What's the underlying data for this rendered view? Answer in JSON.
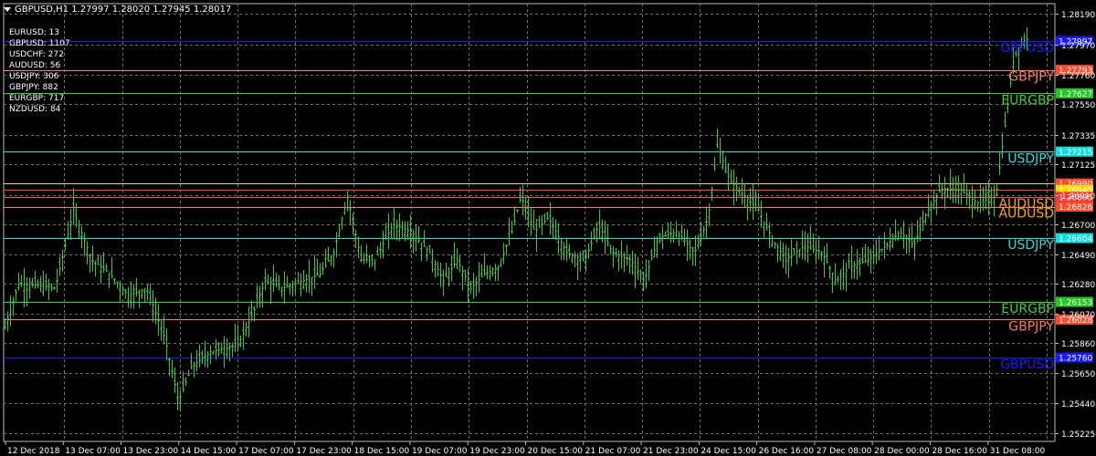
{
  "header": {
    "symbol_info": "GBPUSD,H1  1.27997 1.28020 1.27945 1.28017"
  },
  "counts": [
    {
      "label": "EURUSD: 13"
    },
    {
      "label": "GBPUSD: 1107"
    },
    {
      "label": "USDCHF: 272"
    },
    {
      "label": "AUDUSD: 56"
    },
    {
      "label": "USDJPY: 306"
    },
    {
      "label": "GBPJPY: 882"
    },
    {
      "label": "EURGBP: 717"
    },
    {
      "label": "NZDUSD: 84"
    }
  ],
  "price_axis": {
    "ticks": [
      "1.28190",
      "1.27970",
      "1.27760",
      "1.27550",
      "1.27335",
      "1.27125",
      "1.26910",
      "1.26700",
      "1.26490",
      "1.26280",
      "1.26070",
      "1.25860",
      "1.25650",
      "1.25440",
      "1.25225"
    ]
  },
  "time_axis": {
    "labels": [
      "12 Dec 2018",
      "13 Dec 07:00",
      "13 Dec 23:00",
      "14 Dec 15:00",
      "17 Dec 07:00",
      "17 Dec 23:00",
      "18 Dec 15:00",
      "19 Dec 07:00",
      "19 Dec 23:00",
      "20 Dec 15:00",
      "21 Dec 07:00",
      "21 Dec 23:00",
      "24 Dec 15:00",
      "26 Dec 16:00",
      "27 Dec 08:00",
      "28 Dec 00:00",
      "28 Dec 16:00",
      "31 Dec 08:00"
    ]
  },
  "levels": [
    {
      "price": "1.27997",
      "name": "GBPUSD",
      "line_color": "#1a1aff",
      "box_color": "#1a1aff",
      "text_color": "#1a1aff"
    },
    {
      "price": "1.27793",
      "name": "GBPJPY",
      "line_color": "#ff7a5c",
      "box_color": "#ff4b2b",
      "text_color": "#ff7a5c"
    },
    {
      "price": "1.27627",
      "name": "EURGBP",
      "line_color": "#33d633",
      "box_color": "#22c722",
      "text_color": "#33d633"
    },
    {
      "price": "1.27215",
      "name": "USDJPY",
      "line_color": "#22dddd",
      "box_color": "#11dddd",
      "text_color": "#22dddd"
    },
    {
      "price": "1.26990",
      "name": "",
      "line_color": "#ffd700",
      "box_color": "#ff4b2b",
      "text_color": "#ffa500"
    },
    {
      "price": "1.26945",
      "name": "",
      "line_color": "#ff4b2b",
      "box_color": "#ffd700",
      "text_color": "#ffa500"
    },
    {
      "price": "1.26895",
      "name": "AUDUSD",
      "line_color": "#ff5050",
      "box_color": "#ff3030",
      "text_color": "#ffa500"
    },
    {
      "price": "1.26826",
      "name": "AUDUSD",
      "line_color": "#ff7a5c",
      "box_color": "#ff4b2b",
      "text_color": "#ffa500"
    },
    {
      "price": "1.26604",
      "name": "USDJPY",
      "line_color": "#22dddd",
      "box_color": "#11dddd",
      "text_color": "#22dddd"
    },
    {
      "price": "1.26153",
      "name": "EURGBP",
      "line_color": "#33d633",
      "box_color": "#22c722",
      "text_color": "#33d633"
    },
    {
      "price": "1.26028",
      "name": "GBPJPY",
      "line_color": "#ff7a5c",
      "box_color": "#ff4b2b",
      "text_color": "#ff7a5c"
    },
    {
      "price": "1.25760",
      "name": "GBPUSD",
      "line_color": "#1a1aff",
      "box_color": "#1a1aff",
      "text_color": "#1a1aff"
    }
  ],
  "colors": {
    "background": "#000000",
    "grid": "#6f6f6f",
    "bars": "#33cc33",
    "axis_text": "#ffffff"
  }
}
